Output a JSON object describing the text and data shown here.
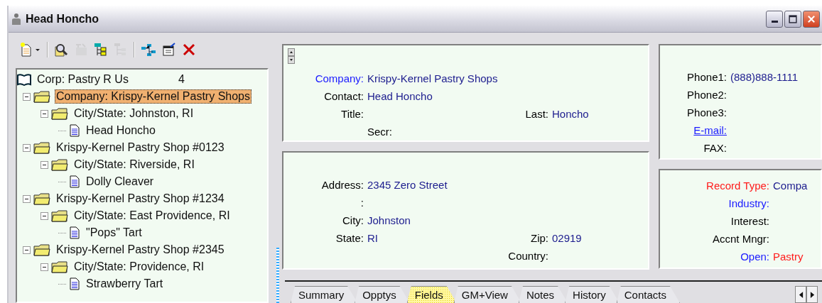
{
  "window": {
    "title": "Head Honcho"
  },
  "toolbar": [
    [
      {
        "kind": "new_menu",
        "disabled": false
      }
    ],
    [
      {
        "kind": "find",
        "disabled": false
      },
      {
        "kind": "schedule",
        "disabled": true
      },
      {
        "kind": "tree_expand",
        "disabled": false
      },
      {
        "kind": "tree_collapse",
        "disabled": true
      }
    ],
    [
      {
        "kind": "network",
        "disabled": false
      },
      {
        "kind": "properties",
        "disabled": false
      },
      {
        "kind": "delete",
        "disabled": false
      }
    ]
  ],
  "tree": [
    {
      "label": "Corp: Pastry R Us",
      "count": "4",
      "kind": "book",
      "selected": false,
      "children": [
        {
          "label": "Company: Krispy-Kernel Pastry Shops",
          "kind": "folder",
          "expanded": true,
          "selected": true,
          "children": [
            {
              "label": "City/State: Johnston, RI",
              "kind": "folder",
              "expanded": true,
              "selected": false,
              "children": [
                {
                  "label": "Head Honcho",
                  "kind": "doc",
                  "selected": false
                }
              ]
            }
          ]
        },
        {
          "label": "Krispy-Kernel Pastry Shop #0123",
          "kind": "folder",
          "expanded": true,
          "selected": false,
          "children": [
            {
              "label": "City/State: Riverside, RI",
              "kind": "folder",
              "expanded": true,
              "selected": false,
              "children": [
                {
                  "label": "Dolly Cleaver",
                  "kind": "doc",
                  "selected": false
                }
              ]
            }
          ]
        },
        {
          "label": "Krispy-Kernel Pastry Shop #1234",
          "kind": "folder",
          "expanded": true,
          "selected": false,
          "children": [
            {
              "label": "City/State: East Providence, RI",
              "kind": "folder",
              "expanded": true,
              "selected": false,
              "children": [
                {
                  "label": "\"Pops\" Tart",
                  "kind": "doc",
                  "selected": false
                }
              ]
            }
          ]
        },
        {
          "label": "Krispy-Kernel Pastry Shop #2345",
          "kind": "folder",
          "expanded": true,
          "selected": false,
          "children": [
            {
              "label": "City/State: Providence, RI",
              "kind": "folder",
              "expanded": true,
              "selected": false,
              "children": [
                {
                  "label": "Strawberry Tart",
                  "kind": "doc",
                  "selected": false
                }
              ]
            }
          ]
        }
      ]
    }
  ],
  "cards": [
    {
      "spinner": true,
      "rows": [
        {
          "left": {
            "label": "Company:",
            "value": "Krispy-Kernel Pastry Shops",
            "kind": "accent",
            "value_alert": false
          }
        },
        {
          "left": {
            "label": "Contact:",
            "value": "Head Honcho",
            "kind": "plain",
            "value_alert": false
          }
        },
        {
          "left": {
            "label": "Title:",
            "kind": "plain"
          },
          "right": {
            "label": "Last:",
            "value": "Honcho",
            "kind": "plain",
            "value_alert": false
          }
        },
        {
          "left": {
            "label": "Secr:",
            "kind": "sub"
          }
        }
      ]
    },
    {
      "spinner": false,
      "rows": [
        {
          "left": {
            "label": "Address:",
            "value": "2345 Zero Street",
            "kind": "plain",
            "value_alert": false
          }
        },
        {
          "left": {
            "label": ":",
            "kind": "plain"
          }
        },
        {
          "left": {
            "label": "City:",
            "value": "Johnston",
            "kind": "plain",
            "value_alert": false
          }
        },
        {
          "left": {
            "label": "State:",
            "value": "RI",
            "kind": "plain",
            "value_alert": false
          },
          "right": {
            "label": "Zip:",
            "value": "02919",
            "kind": "plain",
            "value_alert": false
          }
        },
        {
          "right": {
            "label": "Country:",
            "kind": "plain"
          }
        }
      ]
    },
    {
      "spinner": false,
      "rows": [
        {
          "left": {
            "label": "Phone1:",
            "value": "(888)888-1111",
            "kind": "plain",
            "value_alert": false
          }
        },
        {
          "left": {
            "label": "Phone2:",
            "kind": "plain"
          }
        },
        {
          "left": {
            "label": "Phone3:",
            "kind": "plain"
          }
        },
        {
          "left": {
            "label": "E-mail:",
            "kind": "link"
          }
        },
        {
          "left": {
            "label": "FAX:",
            "kind": "plain"
          }
        }
      ]
    },
    {
      "spinner": false,
      "rows": [
        {
          "left": {
            "label": "Record Type:",
            "value": "Compa",
            "kind": "required",
            "value_alert": false
          }
        },
        {
          "left": {
            "label": "Industry:",
            "kind": "accent"
          }
        },
        {
          "left": {
            "label": "Interest:",
            "kind": "plain"
          }
        },
        {
          "left": {
            "label": "Accnt Mngr:",
            "kind": "plain"
          }
        },
        {
          "left": {
            "label": "Open:",
            "value": "Pastry",
            "kind": "accent",
            "value_alert": true
          }
        }
      ]
    }
  ],
  "tabs": [
    {
      "label": "Summary",
      "selected": false
    },
    {
      "label": "Opptys",
      "selected": false
    },
    {
      "label": "Fields",
      "selected": true
    },
    {
      "label": "GM+View",
      "selected": false
    },
    {
      "label": "Notes",
      "selected": false
    },
    {
      "label": "History",
      "selected": false
    },
    {
      "label": "Contacts",
      "selected": false
    }
  ]
}
